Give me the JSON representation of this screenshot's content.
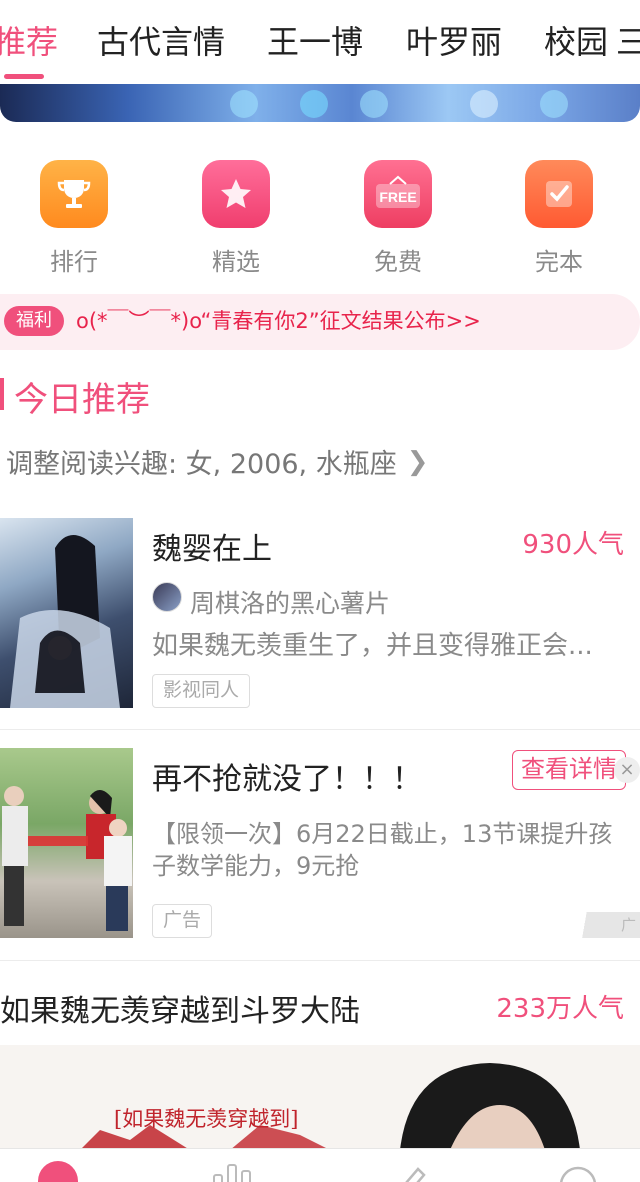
{
  "tabs": [
    {
      "label": "推荐",
      "active": true
    },
    {
      "label": "古代言情",
      "active": false
    },
    {
      "label": "王一博",
      "active": false
    },
    {
      "label": "叶罗丽",
      "active": false
    },
    {
      "label": "校园",
      "active": false
    },
    {
      "label": "三",
      "active": false
    }
  ],
  "quick_entries": [
    {
      "label": "排行",
      "icon": "trophy-icon",
      "color": "#ff9a2e"
    },
    {
      "label": "精选",
      "icon": "star-icon",
      "color": "#f0507c"
    },
    {
      "label": "免费",
      "icon": "free-sign-icon",
      "color": "#f25070",
      "icon_text": "FREE"
    },
    {
      "label": "完本",
      "icon": "check-note-icon",
      "color": "#ff6a3a"
    }
  ],
  "notice": {
    "badge": "福利",
    "text": "o(*￣︶￣*)o“青春有你2”征文结果公布>>"
  },
  "section": {
    "title": "今日推荐",
    "interest": "调整阅读兴趣: 女, 2006, 水瓶座"
  },
  "book1": {
    "title": "魏婴在上",
    "hot": "930人气",
    "author": "周棋洛的黑心薯片",
    "desc": "如果魏无羡重生了，并且变得雅正会...",
    "tag": "影视同人"
  },
  "ad": {
    "title": "再不抢就没了！！！",
    "button": "查看详情",
    "close": "×",
    "desc": "【限领一次】6月22日截止，13节课提升孩子数学能力，9元抢",
    "tag": "广告",
    "mark": "广"
  },
  "story": {
    "title": "如果魏无羡穿越到斗罗大陆",
    "hot": "233万人气",
    "image_text": "[如果魏无羡穿越到]"
  },
  "colors": {
    "accent": "#f0507c",
    "notice_bg": "#fdeef2",
    "notice_text": "#e8244c"
  }
}
